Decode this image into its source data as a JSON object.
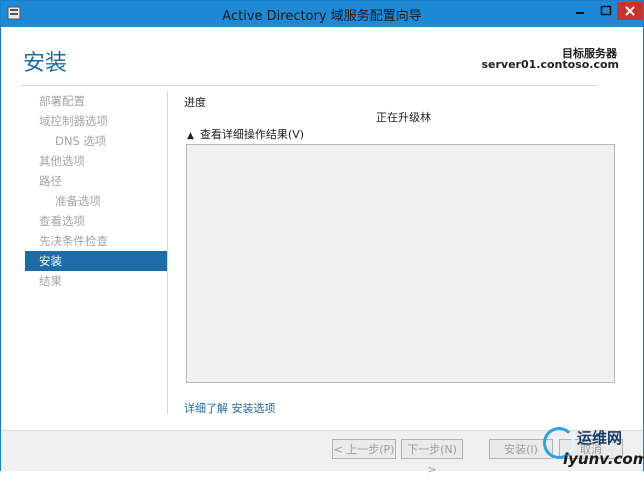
{
  "window": {
    "title": "Active Directory 域服务配置向导"
  },
  "header": {
    "page_title": "安装",
    "target_label": "目标服务器",
    "target_server": "server01.contoso.com"
  },
  "nav": {
    "items": [
      {
        "label": "部署配置",
        "sub": false,
        "active": false
      },
      {
        "label": "域控制器选项",
        "sub": false,
        "active": false
      },
      {
        "label": "DNS 选项",
        "sub": true,
        "active": false
      },
      {
        "label": "其他选项",
        "sub": false,
        "active": false
      },
      {
        "label": "路径",
        "sub": false,
        "active": false
      },
      {
        "label": "准备选项",
        "sub": true,
        "active": false
      },
      {
        "label": "查看选项",
        "sub": false,
        "active": false
      },
      {
        "label": "先决条件检查",
        "sub": false,
        "active": false
      },
      {
        "label": "安装",
        "sub": false,
        "active": true
      },
      {
        "label": "结果",
        "sub": false,
        "active": false
      }
    ]
  },
  "content": {
    "progress_label": "进度",
    "status_text": "正在升级林",
    "details_toggle": "查看详细操作结果(V)",
    "learn_more": "详细了解 安装选项"
  },
  "footer": {
    "prev": "< 上一步(P)",
    "next": "下一步(N) >",
    "install": "安装(I)",
    "cancel": "取消"
  },
  "watermark": {
    "line1": "运维网",
    "line2": "iyunv.com"
  },
  "colors": {
    "titlebar": "#1e8ad6",
    "accent": "#1c6ca8",
    "close": "#c8342c"
  }
}
